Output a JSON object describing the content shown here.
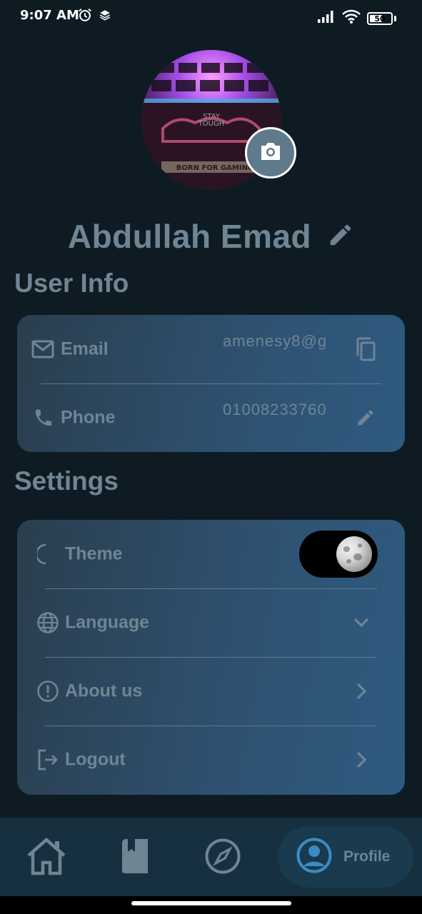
{
  "status_bar": {
    "time": "9:07 AM",
    "battery": "50",
    "icons": [
      "alarm-icon",
      "layers-icon",
      "signal-icon",
      "wifi-icon",
      "battery-icon"
    ]
  },
  "profile": {
    "name": "Abdullah Emad",
    "avatar_icon": "avatar-photo",
    "camera_icon": "camera-icon",
    "edit_icon": "pencil-icon"
  },
  "user_info": {
    "title": "User Info",
    "email": {
      "label": "Email",
      "value": "amenesy8@g",
      "icon": "mail-icon",
      "action_icon": "copy-icon"
    },
    "phone": {
      "label": "Phone",
      "value": "01008233760",
      "icon": "phone-icon",
      "action_icon": "pencil-icon"
    }
  },
  "settings": {
    "title": "Settings",
    "items": [
      {
        "label": "Theme",
        "icon": "moon-outline-icon",
        "control": "toggle",
        "toggle_state": "dark"
      },
      {
        "label": "Language",
        "icon": "globe-icon",
        "control": "chevron-down-icon"
      },
      {
        "label": "About us",
        "icon": "info-icon",
        "control": "chevron-right-icon"
      },
      {
        "label": "Logout",
        "icon": "logout-icon",
        "control": "chevron-right-icon"
      }
    ]
  },
  "bottom_nav": {
    "items": [
      {
        "icon": "home-icon",
        "active": false
      },
      {
        "icon": "book-icon",
        "active": false
      },
      {
        "icon": "compass-icon",
        "active": false
      },
      {
        "icon": "account-circle-icon",
        "label": "Profile",
        "active": true
      }
    ]
  },
  "colors": {
    "background": "#0f1b23",
    "muted_text": "#6f8594",
    "card_gradient_start": "#2a3e4e",
    "card_gradient_end": "#2d5b80",
    "nav_background": "#16303f",
    "active_accent": "#3a8cc4"
  }
}
